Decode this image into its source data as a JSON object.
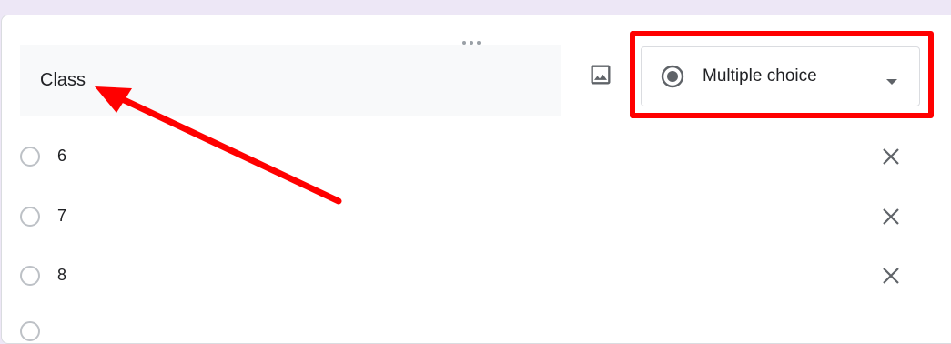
{
  "question": {
    "title": "Class"
  },
  "question_type": {
    "selected": "Multiple choice",
    "icon": "radio-button-checked-icon"
  },
  "options": [
    {
      "label": "6"
    },
    {
      "label": "7"
    },
    {
      "label": "8"
    }
  ],
  "annotations": {
    "highlight_color": "#ff0000",
    "arrow_color": "#ff0000"
  },
  "colors": {
    "page_background": "#ede7f6",
    "card_background": "#ffffff",
    "text": "#202124",
    "icon": "#5f6368"
  }
}
